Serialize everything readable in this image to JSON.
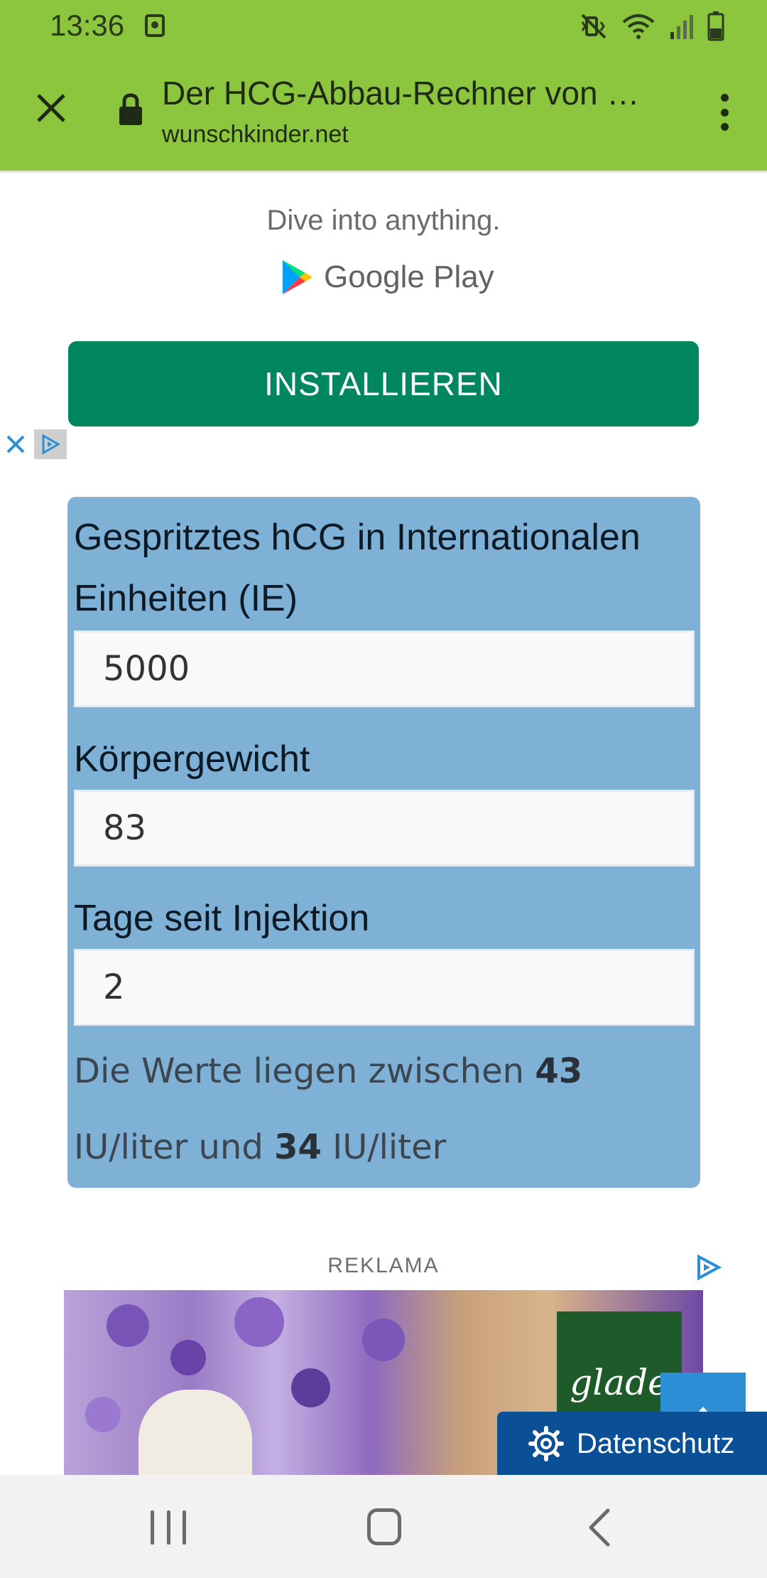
{
  "status_bar": {
    "time": "13:36"
  },
  "browser": {
    "page_title": "Der HCG-Abbau-Rechner von w…",
    "host": "wunschkinder.net"
  },
  "top_ad": {
    "tagline": "Dive into anything.",
    "store_name": "Google Play",
    "install_label": "INSTALLIEREN"
  },
  "calculator": {
    "fields": [
      {
        "label": "Gespritztes hCG in Internationalen Einheiten (IE)",
        "value": "5000"
      },
      {
        "label": "Körpergewicht",
        "value": "83"
      },
      {
        "label": "Tage seit Injektion",
        "value": "2"
      }
    ],
    "result": {
      "prefix": "Die Werte liegen zwischen",
      "high_value": "43",
      "unit_1": "IU/liter",
      "connector": "und",
      "low_value": "34",
      "unit_2": "IU/liter"
    }
  },
  "bottom_ad": {
    "label": "REKLAMA",
    "brand": "glade"
  },
  "privacy_button": {
    "label": "Datenschutz"
  },
  "colors": {
    "browser_bar": "#8cc63f",
    "install_button": "#01875f",
    "calculator_panel": "#7fb0d5",
    "privacy_button": "#0b4f96"
  }
}
